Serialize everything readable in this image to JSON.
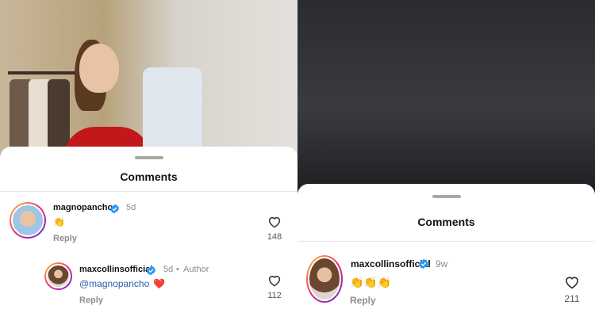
{
  "left": {
    "sheet_title": "Comments",
    "comments": [
      {
        "username": "magnopancho",
        "time": "5d",
        "text": "👏",
        "reply_label": "Reply",
        "likes": "148"
      },
      {
        "username": "maxcollinsofficial",
        "time": "5d",
        "separator": "•",
        "author_tag": "Author",
        "mention": "@magnopancho",
        "emoji": "❤️",
        "reply_label": "Reply",
        "likes": "112"
      }
    ]
  },
  "right": {
    "sheet_title": "Comments",
    "comments": [
      {
        "username": "maxcollinsofficial",
        "time": "9w",
        "text": "👏👏👏",
        "reply_label": "Reply",
        "likes": "211"
      }
    ]
  },
  "colors": {
    "verified": "#2b95f6",
    "mention": "#2d5fa8",
    "heart": "#e0121b"
  },
  "icons": [
    "verified-badge-icon",
    "heart-outline-icon",
    "drag-handle"
  ]
}
